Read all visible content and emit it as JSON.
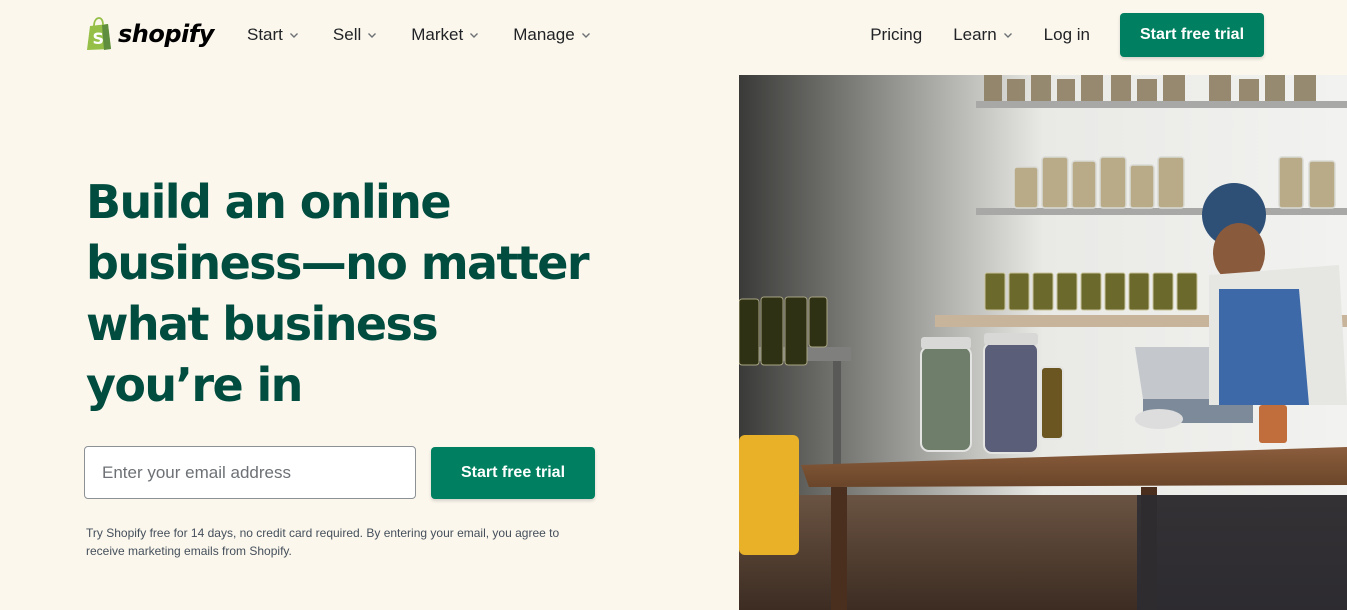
{
  "brand": {
    "name": "shopify",
    "accent": "#008060",
    "headline_color": "#004c3f",
    "bag_color": "#95bf47"
  },
  "nav": {
    "left_items": [
      {
        "label": "Start",
        "icon": "chevron-down-icon"
      },
      {
        "label": "Sell",
        "icon": "chevron-down-icon"
      },
      {
        "label": "Market",
        "icon": "chevron-down-icon"
      },
      {
        "label": "Manage",
        "icon": "chevron-down-icon"
      }
    ],
    "pricing_label": "Pricing",
    "learn_label": "Learn",
    "login_label": "Log in",
    "cta_label": "Start free trial"
  },
  "hero": {
    "headline_lines": [
      "Build an online",
      "business—no matter",
      "what business",
      "you’re in"
    ],
    "email_placeholder": "Enter your email address",
    "email_value": "",
    "cta_label": "Start free trial",
    "disclaimer_line1": "Try Shopify free for 14 days, no credit card required. By entering your email, you agree to",
    "disclaimer_line2": "receive marketing emails from Shopify."
  }
}
